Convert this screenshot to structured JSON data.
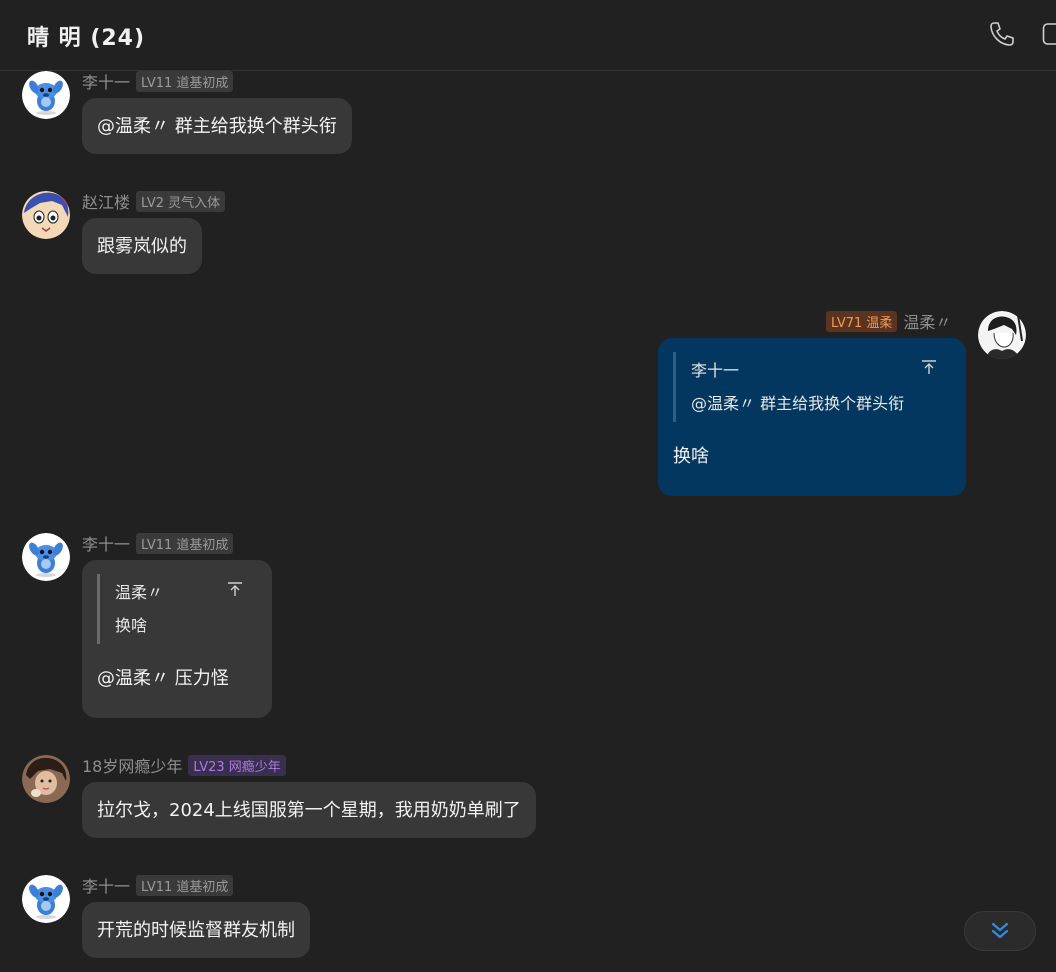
{
  "header": {
    "title": "晴 明 (24)",
    "call_icon": "phone-icon",
    "window_icon": "window-icon"
  },
  "messages": [
    {
      "id": "m1",
      "name": "李十一",
      "badge": "LV11 道基初成",
      "text": "@温柔〃 群主给我换个群头衔",
      "avatar": "stitch-avatar"
    },
    {
      "id": "m2",
      "name": "赵江楼",
      "badge": "LV2 灵气入体",
      "text": "跟雾岚似的",
      "avatar": "anime-avatar"
    },
    {
      "id": "m3",
      "name": "温柔〃",
      "badge": "LV71 温柔",
      "badge_color": "#f09a55",
      "quote_name": "李十一",
      "quote_text": "@温柔〃 群主给我换个群头衔",
      "text": "换啥",
      "avatar": "sketch-avatar",
      "bubble_color": "#03375f"
    },
    {
      "id": "m4",
      "name": "李十一",
      "badge": "LV11 道基初成",
      "quote_name": "温柔〃",
      "quote_text": "换啥",
      "text": "@温柔〃 压力怪",
      "avatar": "stitch-avatar"
    },
    {
      "id": "m5",
      "name": "18岁网瘾少年",
      "badge": "LV23 网瘾少年",
      "badge_color": "#a77be0",
      "text": "拉尔戈，2024上线国服第一个星期，我用奶奶单刷了",
      "avatar": "photo-avatar"
    },
    {
      "id": "m6",
      "name": "李十一",
      "badge": "LV11 道基初成",
      "text": "开荒的时候监督群友机制",
      "avatar": "stitch-avatar"
    }
  ],
  "scroll_button": {
    "icon": "double-chevron-down-icon",
    "color": "#2f8de4"
  },
  "colors": {
    "background": "#212121",
    "bubble": "#383838",
    "self_bubble": "#03375f"
  }
}
